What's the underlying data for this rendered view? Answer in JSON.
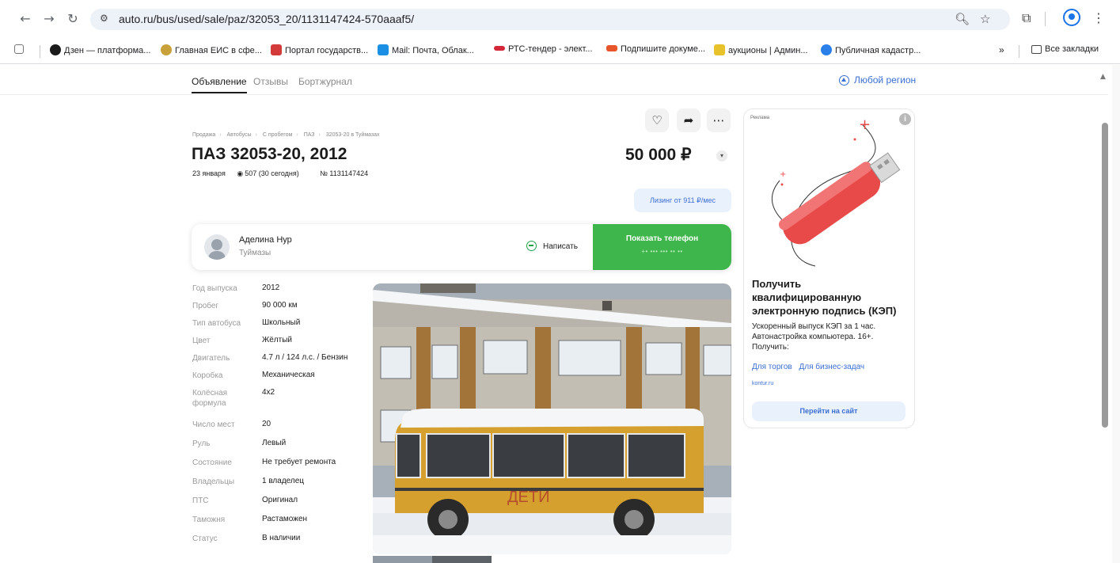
{
  "browser": {
    "url": "auto.ru/bus/used/sale/paz/32053_20/1131147424-570aaaf5/",
    "bookmarks": [
      {
        "label": "Дзен — платформа...",
        "color": "#1b1b1b"
      },
      {
        "label": "Главная ЕИС в сфе...",
        "color": "#c9a13b"
      },
      {
        "label": "Портал государств...",
        "color": "#d33b3b"
      },
      {
        "label": "Mail: Почта, Облак...",
        "color": "#1a8fe3"
      },
      {
        "label": "РТС-тендер - элект...",
        "color": "#d5273a"
      },
      {
        "label": "Подпишите докуме...",
        "color": "#e8552b"
      },
      {
        "label": "аукционы | Админ...",
        "color": "#e8c22b"
      },
      {
        "label": "Публичная кадастр...",
        "color": "#2b7fe8"
      }
    ],
    "more_bookmarks": "»",
    "all_bookmarks": "Все закладки"
  },
  "tabs": [
    {
      "label": "Объявление",
      "active": true
    },
    {
      "label": "Отзывы",
      "active": false
    },
    {
      "label": "Бортжурнал",
      "active": false
    }
  ],
  "region": "Любой регион",
  "breadcrumbs": [
    "Продажа",
    "Автобусы",
    "С пробегом",
    "ПАЗ",
    "32053-20 в Туймазах"
  ],
  "listing": {
    "title": "ПАЗ 32053-20, 2012",
    "price": "50 000 ₽",
    "date": "23 января",
    "views": "507 (30 сегодня)",
    "number": "№ 1131147424",
    "leasing": "Лизинг от 911 ₽/мес"
  },
  "seller": {
    "name": "Аделина Нур",
    "city": "Туймазы",
    "write_label": "Написать",
    "phone_label": "Показать телефон",
    "phone_masked": "+• ••• ••• •• ••"
  },
  "specs": [
    {
      "key": "Год выпуска",
      "value": "2012"
    },
    {
      "key": "Пробег",
      "value": "90 000 км"
    },
    {
      "key": "Тип автобуса",
      "value": "Школьный"
    },
    {
      "key": "Цвет",
      "value": "Жёлтый"
    },
    {
      "key": "Двигатель",
      "value": "4.7 л / 124 л.с. / Бензин"
    },
    {
      "key": "Коробка",
      "value": "Механическая"
    },
    {
      "key": "Колёсная формула",
      "value": "4x2"
    },
    {
      "key": "Число мест",
      "value": "20"
    },
    {
      "key": "Руль",
      "value": "Левый"
    },
    {
      "key": "Состояние",
      "value": "Не требует ремонта"
    },
    {
      "key": "Владельцы",
      "value": "1 владелец"
    },
    {
      "key": "ПТС",
      "value": "Оригинал"
    },
    {
      "key": "Таможня",
      "value": "Растаможен"
    },
    {
      "key": "Статус",
      "value": "В наличии"
    }
  ],
  "photo": {
    "bus_text": "ДЕТИ"
  },
  "ad": {
    "label": "Реклама",
    "title": "Получить квалифицированную электронную подпись (КЭП)",
    "text": "Ускоренный выпуск КЭП за 1 час. Автонастройка компьютера. 16+. Получить:",
    "links": [
      "Для торгов",
      "Для бизнес-задач"
    ],
    "domain": "kontur.ru",
    "button": "Перейти на сайт"
  }
}
